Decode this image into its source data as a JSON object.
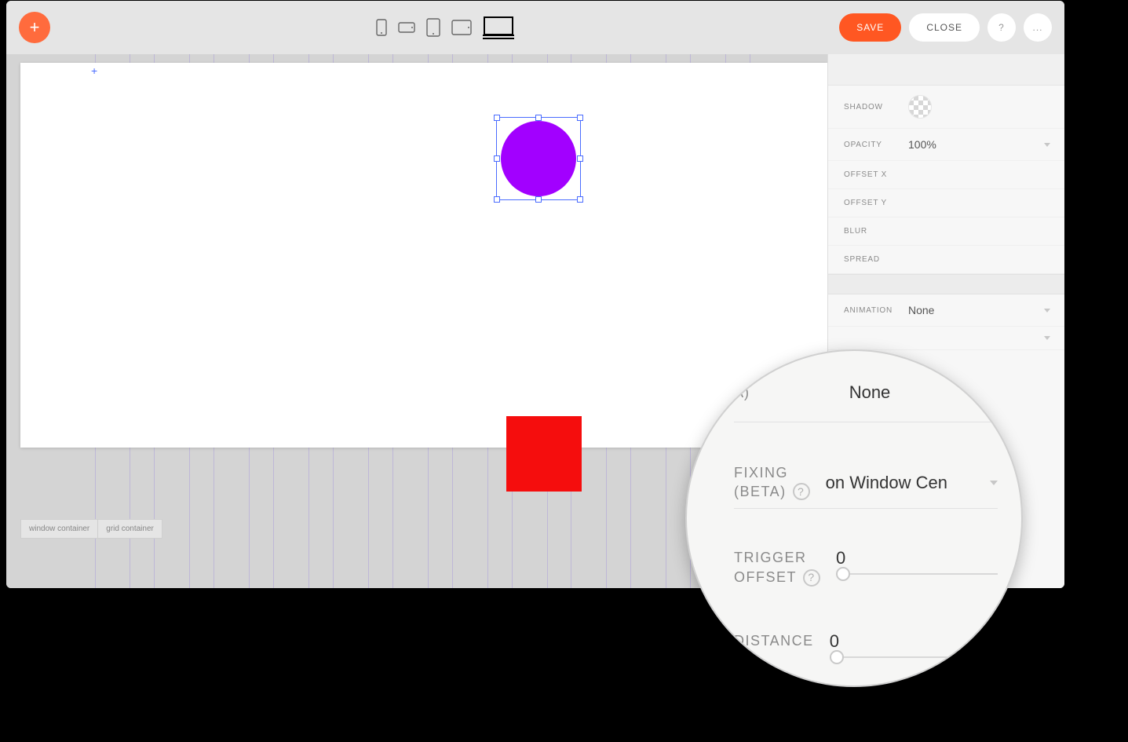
{
  "toolbar": {
    "add_label": "+",
    "save_label": "SAVE",
    "close_label": "CLOSE",
    "help_label": "?",
    "more_label": "..."
  },
  "devices": {
    "phone_portrait": "phone-portrait",
    "phone_landscape": "phone-landscape",
    "tablet_portrait": "tablet-portrait",
    "tablet_landscape": "tablet-landscape",
    "desktop": "desktop"
  },
  "breadcrumbs": {
    "item1": "window container",
    "item2": "grid container"
  },
  "canvas": {
    "origin_mark": "+",
    "circle_color": "#a200ff",
    "square_color": "#f50d0d"
  },
  "panel": {
    "shadow_label": "SHADOW",
    "opacity_label": "OPACITY",
    "opacity_value": "100%",
    "offsetx_label": "OFFSET X",
    "offsety_label": "OFFSET Y",
    "blur_label": "BLUR",
    "spread_label": "SPREAD",
    "animation_label": "ANIMATION",
    "animation_value": "None"
  },
  "magnifier": {
    "top_partial_label": "A)",
    "top_value": "None",
    "fixing_l1": "FIXING",
    "fixing_l2": "(BETA)",
    "fixing_help": "?",
    "fixing_value": "on Window Cen",
    "trigger_l1": "TRIGGER",
    "trigger_l2": "OFFSET",
    "trigger_help": "?",
    "trigger_value": "0",
    "distance_label": "DISTANCE",
    "distance_value": "0"
  }
}
